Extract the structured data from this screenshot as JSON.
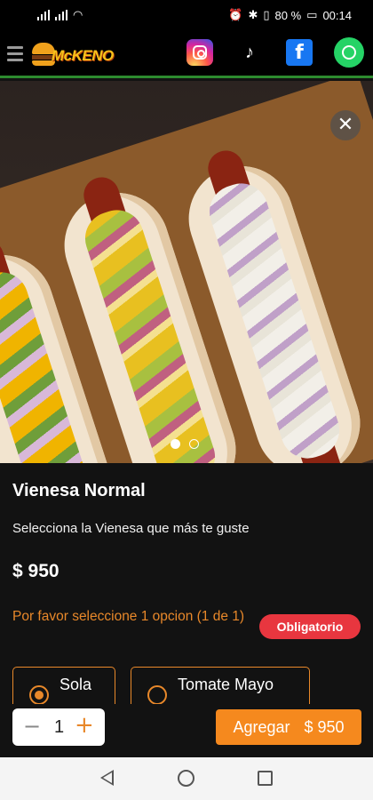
{
  "statusbar": {
    "battery_percent": "80 %",
    "time": "00:14"
  },
  "header": {
    "brand": "McKENO",
    "social": [
      "instagram-icon",
      "tiktok-icon",
      "facebook-icon",
      "whatsapp-icon"
    ]
  },
  "gallery": {
    "slides": 2,
    "active_slide": 1
  },
  "product": {
    "name": "Vienesa Normal",
    "description": "Selecciona la Vienesa que más te guste",
    "price": "$ 950"
  },
  "options": {
    "prompt": "Por favor seleccione 1 opcion (1 de 1)",
    "required_label": "Obligatorio",
    "items": [
      {
        "label": "Sola",
        "selected": true
      },
      {
        "label": "Tomate Mayo",
        "selected": false
      }
    ]
  },
  "cart": {
    "quantity": "1",
    "add_label": "Agregar",
    "add_price": "$ 950"
  },
  "colors": {
    "accent": "#f5891e",
    "required": "#e8363f",
    "header_line": "#2d8b2f"
  }
}
